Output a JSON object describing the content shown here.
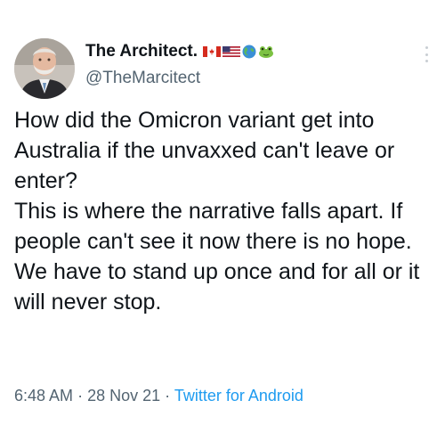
{
  "author": {
    "display_name": "The Architect.",
    "handle": "@TheMarcitect",
    "badges": [
      "canada-flag-icon",
      "usa-flag-icon",
      "globe-icon",
      "frog-icon"
    ]
  },
  "tweet": {
    "lines": [
      "How did the Omicron variant get into Australia if the unvaxxed can't leave or enter?",
      "This is where the narrative falls apart. If people can't see it now there is no hope. We have to stand up once and for all or it will never stop."
    ]
  },
  "meta": {
    "time": "6:48 AM",
    "separator": "·",
    "date": "28 Nov 21",
    "source": "Twitter for Android"
  },
  "colors": {
    "text": "#0f1419",
    "secondary": "#536471",
    "link": "#1d9bf0"
  }
}
